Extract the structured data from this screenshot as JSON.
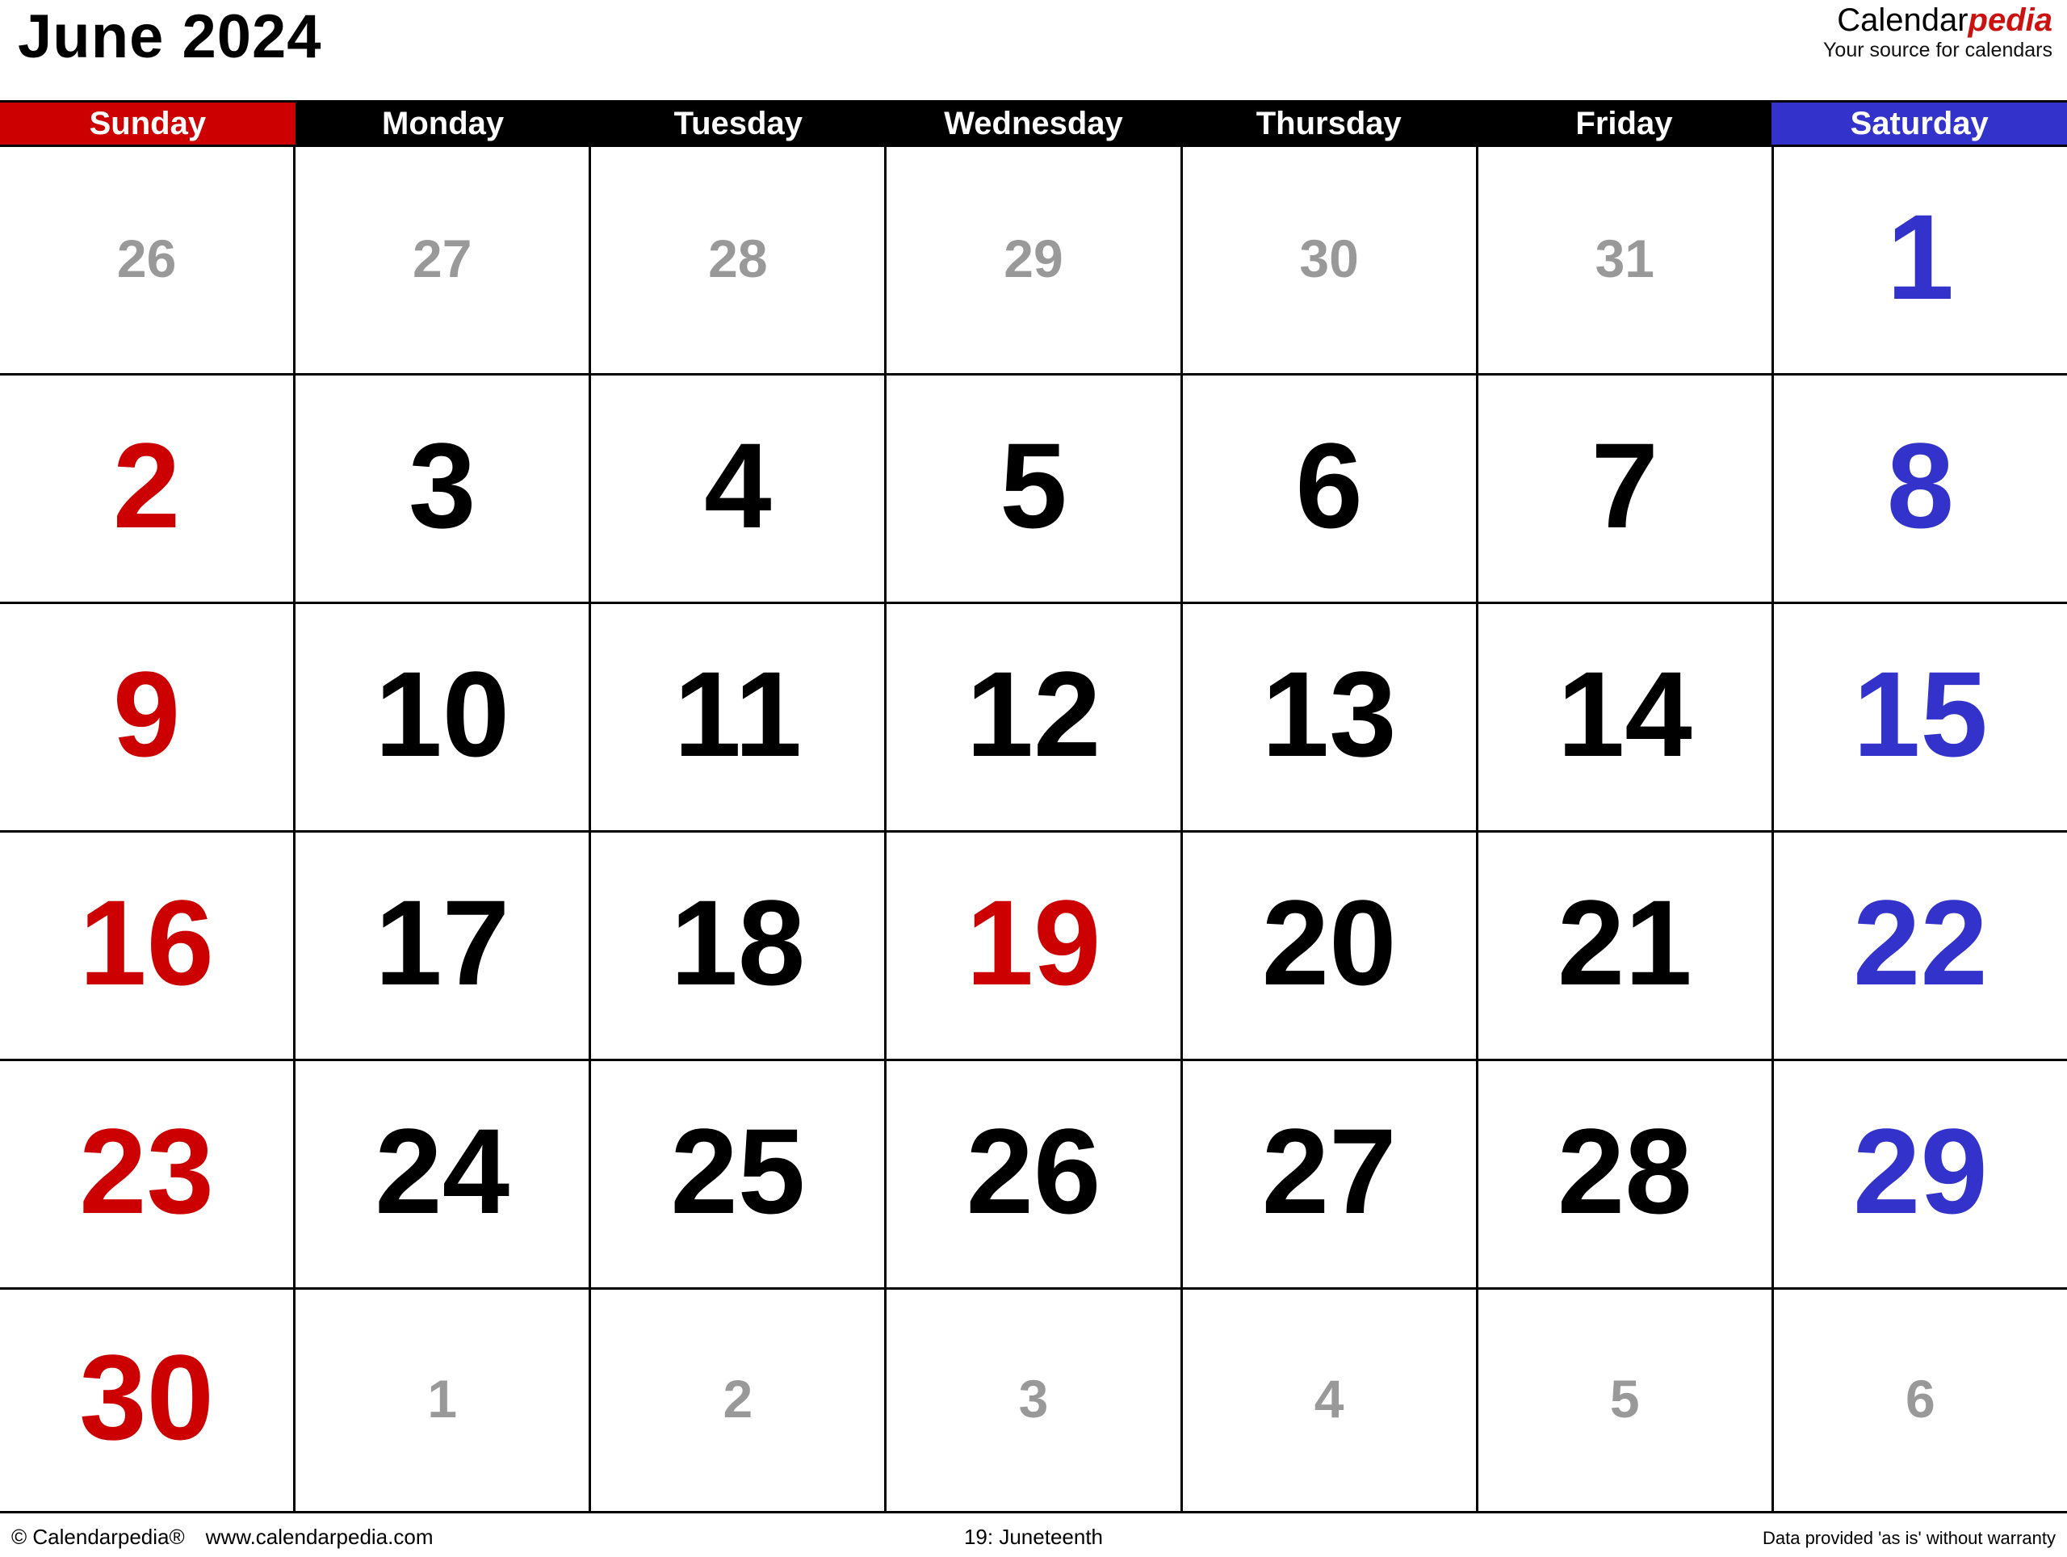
{
  "header": {
    "title": "June 2024",
    "brand": {
      "name_part1": "Calendar",
      "name_part2": "pedia",
      "tagline": "Your source for calendars"
    }
  },
  "colors": {
    "sunday_red": "#CC0000",
    "saturday_blue": "#3333CC",
    "weekday_black": "#000000",
    "other_month_gray": "#999999",
    "brand_red": "#CC1111"
  },
  "weekdays": [
    {
      "label": "Sunday",
      "style": "sun"
    },
    {
      "label": "Monday",
      "style": "wd"
    },
    {
      "label": "Tuesday",
      "style": "wd"
    },
    {
      "label": "Wednesday",
      "style": "wd"
    },
    {
      "label": "Thursday",
      "style": "wd"
    },
    {
      "label": "Friday",
      "style": "wd"
    },
    {
      "label": "Saturday",
      "style": "sat"
    }
  ],
  "weeks": [
    [
      {
        "day": "26",
        "kind": "out"
      },
      {
        "day": "27",
        "kind": "out"
      },
      {
        "day": "28",
        "kind": "out"
      },
      {
        "day": "29",
        "kind": "out"
      },
      {
        "day": "30",
        "kind": "out"
      },
      {
        "day": "31",
        "kind": "out"
      },
      {
        "day": "1",
        "kind": "sat"
      }
    ],
    [
      {
        "day": "2",
        "kind": "sun"
      },
      {
        "day": "3",
        "kind": "wd"
      },
      {
        "day": "4",
        "kind": "wd"
      },
      {
        "day": "5",
        "kind": "wd"
      },
      {
        "day": "6",
        "kind": "wd"
      },
      {
        "day": "7",
        "kind": "wd"
      },
      {
        "day": "8",
        "kind": "sat"
      }
    ],
    [
      {
        "day": "9",
        "kind": "sun"
      },
      {
        "day": "10",
        "kind": "wd"
      },
      {
        "day": "11",
        "kind": "wd"
      },
      {
        "day": "12",
        "kind": "wd"
      },
      {
        "day": "13",
        "kind": "wd"
      },
      {
        "day": "14",
        "kind": "wd"
      },
      {
        "day": "15",
        "kind": "sat"
      }
    ],
    [
      {
        "day": "16",
        "kind": "sun"
      },
      {
        "day": "17",
        "kind": "wd"
      },
      {
        "day": "18",
        "kind": "wd"
      },
      {
        "day": "19",
        "kind": "holiday"
      },
      {
        "day": "20",
        "kind": "wd"
      },
      {
        "day": "21",
        "kind": "wd"
      },
      {
        "day": "22",
        "kind": "sat"
      }
    ],
    [
      {
        "day": "23",
        "kind": "sun"
      },
      {
        "day": "24",
        "kind": "wd"
      },
      {
        "day": "25",
        "kind": "wd"
      },
      {
        "day": "26",
        "kind": "wd"
      },
      {
        "day": "27",
        "kind": "wd"
      },
      {
        "day": "28",
        "kind": "wd"
      },
      {
        "day": "29",
        "kind": "sat"
      }
    ],
    [
      {
        "day": "30",
        "kind": "sun"
      },
      {
        "day": "1",
        "kind": "out"
      },
      {
        "day": "2",
        "kind": "out"
      },
      {
        "day": "3",
        "kind": "out"
      },
      {
        "day": "4",
        "kind": "out"
      },
      {
        "day": "5",
        "kind": "out"
      },
      {
        "day": "6",
        "kind": "out"
      }
    ]
  ],
  "holidays": [
    {
      "text": "19: Juneteenth"
    }
  ],
  "footer": {
    "copyright": "© Calendarpedia®",
    "website": "www.calendarpedia.com",
    "holiday_note": "19: Juneteenth",
    "disclaimer": "Data provided 'as is' without warranty"
  }
}
